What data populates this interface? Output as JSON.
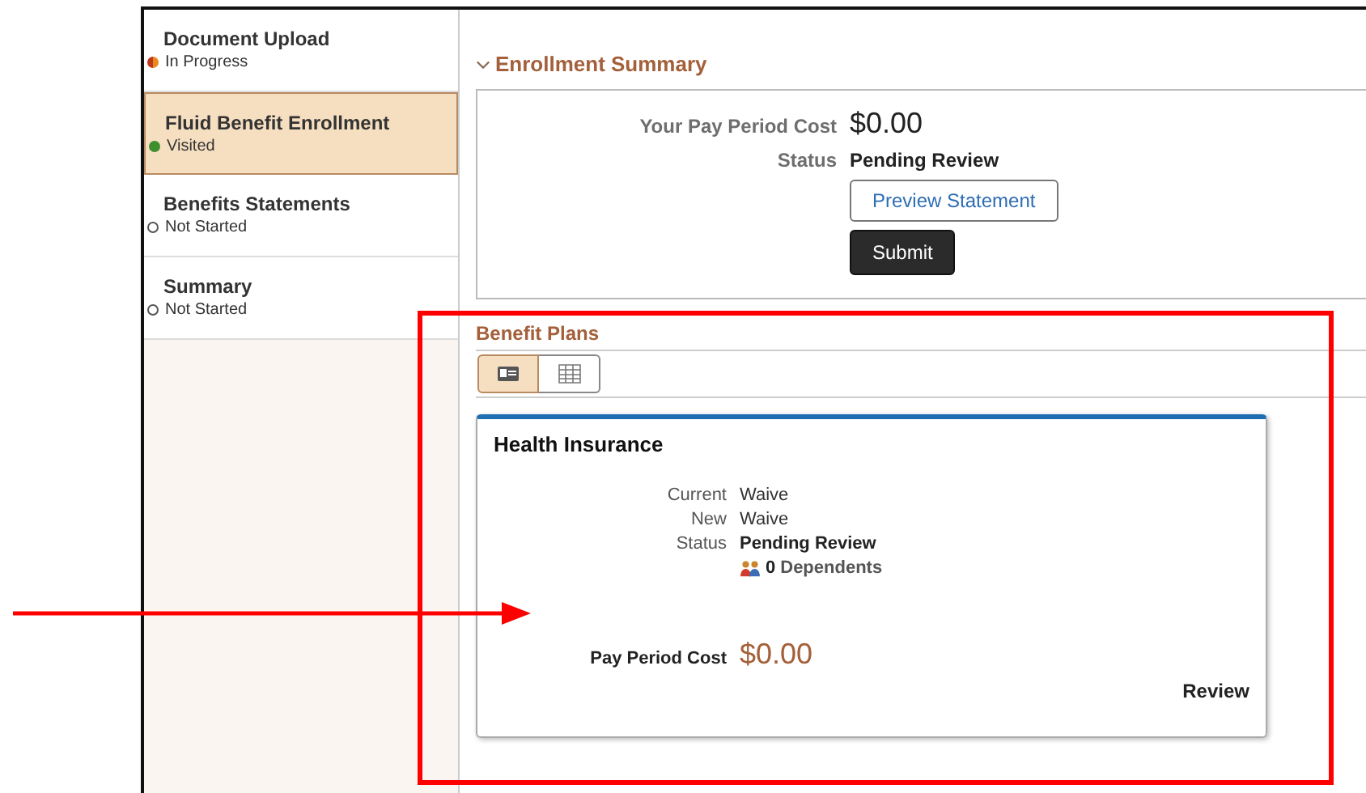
{
  "sidebar": {
    "items": [
      {
        "title": "Document Upload",
        "status": "In Progress",
        "kind": "in-progress",
        "selected": false
      },
      {
        "title": "Fluid Benefit Enrollment",
        "status": "Visited",
        "kind": "visited",
        "selected": true
      },
      {
        "title": "Benefits Statements",
        "status": "Not Started",
        "kind": "not-started",
        "selected": false
      },
      {
        "title": "Summary",
        "status": "Not Started",
        "kind": "not-started",
        "selected": false
      }
    ]
  },
  "enrollment_summary": {
    "heading": "Enrollment Summary",
    "expanded": true,
    "cost_label": "Your Pay Period Cost",
    "cost": "$0.00",
    "status_label": "Status",
    "status": "Pending Review",
    "buttons": [
      {
        "label": "Preview Statement",
        "kind": "secondary"
      },
      {
        "label": "Submit",
        "kind": "primary"
      }
    ]
  },
  "benefit_plans": {
    "heading": "Benefit Plans",
    "views": [
      {
        "kind": "tile",
        "selected": true
      },
      {
        "kind": "grid",
        "selected": false
      }
    ],
    "card": {
      "title": "Health Insurance",
      "fields": [
        {
          "label": "Current",
          "value": "Waive",
          "kind": "plain"
        },
        {
          "label": "New",
          "value": "Waive",
          "kind": "plain"
        },
        {
          "label": "Status",
          "value": "Pending Review",
          "kind": "bold"
        }
      ],
      "dependents_count": "0",
      "dependents_label": "Dependents",
      "cost_label": "Pay Period Cost",
      "cost": "$0.00",
      "action": "Review"
    }
  }
}
